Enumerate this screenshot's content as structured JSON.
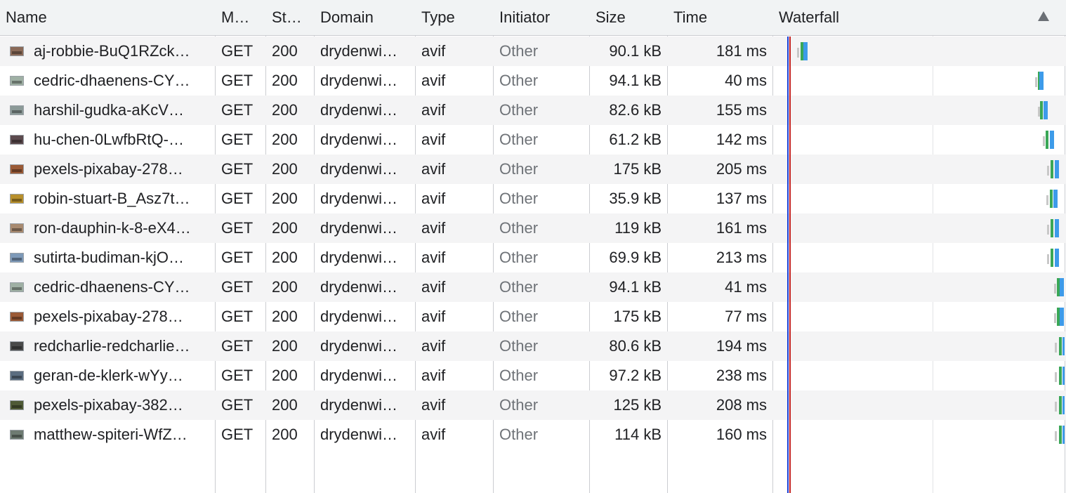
{
  "columns": {
    "name": "Name",
    "method": "M…",
    "status": "St…",
    "domain": "Domain",
    "type": "Type",
    "initiator": "Initiator",
    "size": "Size",
    "time": "Time",
    "waterfall": "Waterfall"
  },
  "sort": {
    "column": "waterfall",
    "direction": "ascending",
    "icon": "sort-up-triangle-icon"
  },
  "colors": {
    "header_bg": "#f1f3f4",
    "row_alt_bg": "#f4f4f5",
    "waiting": "#c8c8c8",
    "ttfb": "#3aa757",
    "download": "#3d9be9",
    "dom_content_loaded_line": "#1a3fd6",
    "load_line": "#c5221f"
  },
  "rows": [
    {
      "name": "aj-robbie-BuQ1RZck…",
      "method": "GET",
      "status": "200",
      "domain": "drydenwi…",
      "type": "avif",
      "initiator": "Other",
      "size": "90.1 kB",
      "time": "181 ms",
      "thumb": "#8a6a58"
    },
    {
      "name": "cedric-dhaenens-CY…",
      "method": "GET",
      "status": "200",
      "domain": "drydenwi…",
      "type": "avif",
      "initiator": "Other",
      "size": "94.1 kB",
      "time": "40 ms",
      "thumb": "#9fb0a4"
    },
    {
      "name": "harshil-gudka-aKcV…",
      "method": "GET",
      "status": "200",
      "domain": "drydenwi…",
      "type": "avif",
      "initiator": "Other",
      "size": "82.6 kB",
      "time": "155 ms",
      "thumb": "#8c9a98"
    },
    {
      "name": "hu-chen-0LwfbRtQ-…",
      "method": "GET",
      "status": "200",
      "domain": "drydenwi…",
      "type": "avif",
      "initiator": "Other",
      "size": "61.2 kB",
      "time": "142 ms",
      "thumb": "#5c4a4e"
    },
    {
      "name": "pexels-pixabay-278…",
      "method": "GET",
      "status": "200",
      "domain": "drydenwi…",
      "type": "avif",
      "initiator": "Other",
      "size": "175 kB",
      "time": "205 ms",
      "thumb": "#9a5a36"
    },
    {
      "name": "robin-stuart-B_Asz7t…",
      "method": "GET",
      "status": "200",
      "domain": "drydenwi…",
      "type": "avif",
      "initiator": "Other",
      "size": "35.9 kB",
      "time": "137 ms",
      "thumb": "#b8902c"
    },
    {
      "name": "ron-dauphin-k-8-eX4…",
      "method": "GET",
      "status": "200",
      "domain": "drydenwi…",
      "type": "avif",
      "initiator": "Other",
      "size": "119 kB",
      "time": "161 ms",
      "thumb": "#a88a70"
    },
    {
      "name": "sutirta-budiman-kjO…",
      "method": "GET",
      "status": "200",
      "domain": "drydenwi…",
      "type": "avif",
      "initiator": "Other",
      "size": "69.9 kB",
      "time": "213 ms",
      "thumb": "#7d99b8"
    },
    {
      "name": "cedric-dhaenens-CY…",
      "method": "GET",
      "status": "200",
      "domain": "drydenwi…",
      "type": "avif",
      "initiator": "Other",
      "size": "94.1 kB",
      "time": "41 ms",
      "thumb": "#9fb0a4"
    },
    {
      "name": "pexels-pixabay-278…",
      "method": "GET",
      "status": "200",
      "domain": "drydenwi…",
      "type": "avif",
      "initiator": "Other",
      "size": "175 kB",
      "time": "77 ms",
      "thumb": "#9a5a36"
    },
    {
      "name": "redcharlie-redcharlie…",
      "method": "GET",
      "status": "200",
      "domain": "drydenwi…",
      "type": "avif",
      "initiator": "Other",
      "size": "80.6 kB",
      "time": "194 ms",
      "thumb": "#4a4a4a"
    },
    {
      "name": "geran-de-klerk-wYy…",
      "method": "GET",
      "status": "200",
      "domain": "drydenwi…",
      "type": "avif",
      "initiator": "Other",
      "size": "97.2 kB",
      "time": "238 ms",
      "thumb": "#5b6d80"
    },
    {
      "name": "pexels-pixabay-382…",
      "method": "GET",
      "status": "200",
      "domain": "drydenwi…",
      "type": "avif",
      "initiator": "Other",
      "size": "125 kB",
      "time": "208 ms",
      "thumb": "#4f5a36"
    },
    {
      "name": "matthew-spiteri-WfZ…",
      "method": "GET",
      "status": "200",
      "domain": "drydenwi…",
      "type": "avif",
      "initiator": "Other",
      "size": "114 kB",
      "time": "160 ms",
      "thumb": "#6e7b72"
    }
  ]
}
